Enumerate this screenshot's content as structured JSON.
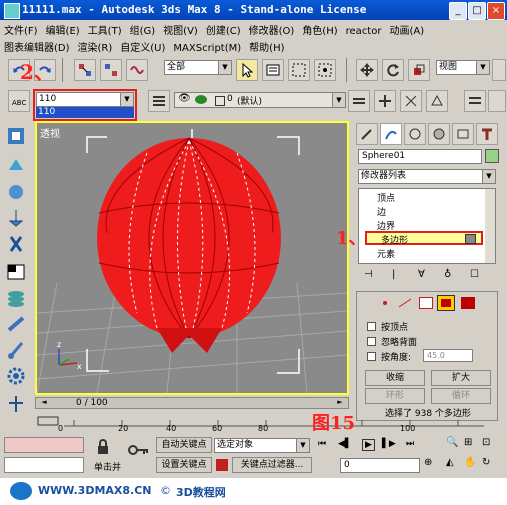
{
  "window": {
    "title": "11111.max - Autodesk 3ds Max 8 - Stand-alone License",
    "minimize": "_",
    "maximize": "□",
    "close": "×"
  },
  "menu": [
    "文件(F)",
    "编辑(E)",
    "工具(T)",
    "组(G)",
    "视图(V)",
    "创建(C)",
    "修改器(O)",
    "角色(H)",
    "reactor",
    "动画(A)"
  ],
  "menu2": [
    "图表编辑器(D)",
    "渲染(R)",
    "自定义(U)",
    "MAXScript(M)",
    "帮助(H)"
  ],
  "toolbar": {
    "selection_filter": "全部",
    "view_dropdown": "视图",
    "layer_label": "(默认)",
    "layer_index": "0"
  },
  "named_selection": {
    "value": "110",
    "option": "110"
  },
  "viewport": {
    "label": "透视",
    "border_color": "#ffff33",
    "object_color": "#ee1c1c"
  },
  "command_panel": {
    "object_name": "Sphere01",
    "modifier_list": "修改器列表",
    "stack": [
      "顶点",
      "边",
      "边界",
      "多边形",
      "元素"
    ],
    "selected_stack": "多边形",
    "selection": {
      "by_vertex": "按顶点",
      "ignore_backface": "忽略背面",
      "by_angle": "按角度:",
      "angle_value": "45.0",
      "shrink": "收缩",
      "grow": "扩大",
      "ring": "环形",
      "loop": "循环",
      "status": "选择了 938 个多边形"
    }
  },
  "timeline": {
    "frame": "0 / 100",
    "ticks": [
      "0",
      "20",
      "40",
      "60",
      "80",
      "100"
    ]
  },
  "bottom": {
    "auto_key": "自动关键点",
    "set_key": "设置关键点",
    "selected_object": "选定对象",
    "key_filters": "关键点过滤器...",
    "frame_field": "0",
    "click_label": "单击并"
  },
  "annotations": {
    "mark_2": "2、",
    "mark_1": "1、",
    "figure": "图15"
  },
  "footer": {
    "site1": "WWW.3DMAX8.CN",
    "site2": "3D教程网"
  }
}
